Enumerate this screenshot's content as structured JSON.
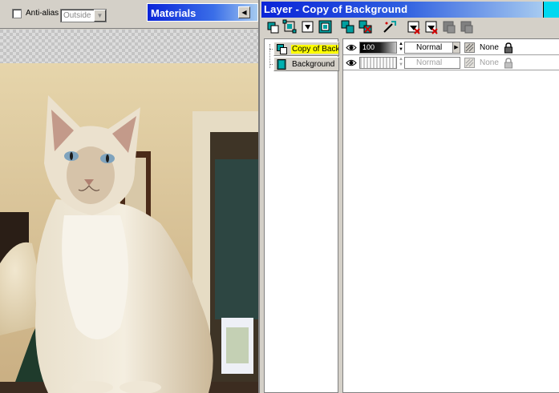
{
  "options_bar": {
    "antialias_label": "Anti-alias",
    "mode_value": "Outside"
  },
  "materials_palette": {
    "title": "Materials"
  },
  "layer_palette": {
    "title": "Layer - Copy of Background",
    "layers": [
      {
        "name": "Copy of Background",
        "visible_name": "Copy of Back",
        "selected": true,
        "opacity": "100",
        "blend_mode": "Normal",
        "mask": "None",
        "enabled": true
      },
      {
        "name": "Background",
        "visible_name": "Background",
        "selected": false,
        "opacity": "",
        "blend_mode": "Normal",
        "mask": "None",
        "enabled": false
      }
    ]
  },
  "colors": {
    "title_bar_start": "#0a24d8",
    "title_bar_end": "#a6caf0",
    "selected_layer_highlight": "#ffff00",
    "layer_icon": "#008080",
    "palette_bg": "#d4d0c8"
  },
  "icons": [
    "new-raster-layer-icon",
    "new-vector-layer-icon",
    "new-mask-layer-icon",
    "new-adjustment-layer-icon",
    "duplicate-layer-icon",
    "delete-layer-icon",
    "layer-properties-icon",
    "mask-show-icon",
    "mask-hide-icon",
    "mask-delete-icon",
    "mask-merge-icon",
    "eye-icon",
    "lock-icon"
  ]
}
